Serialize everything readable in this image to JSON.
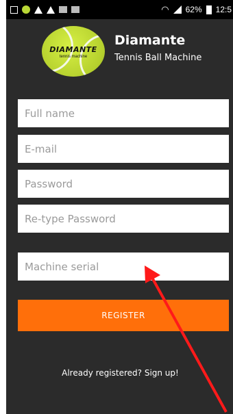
{
  "status_bar": {
    "battery": "62%",
    "time": "12:5"
  },
  "header": {
    "logo_text": "DIAMANTE",
    "logo_subtext": "tennis machine",
    "title": "Diamante",
    "subtitle": "Tennis Ball Machine"
  },
  "form": {
    "full_name_placeholder": "Full name",
    "email_placeholder": "E-mail",
    "password_placeholder": "Password",
    "retype_password_placeholder": "Re-type Password",
    "machine_serial_placeholder": "Machine serial",
    "register_label": "REGISTER",
    "signup_link": "Already registered? Sign up!"
  },
  "colors": {
    "background": "#2b2b2b",
    "accent": "#ff6f0a",
    "annotation_arrow": "#ff1a1a"
  }
}
